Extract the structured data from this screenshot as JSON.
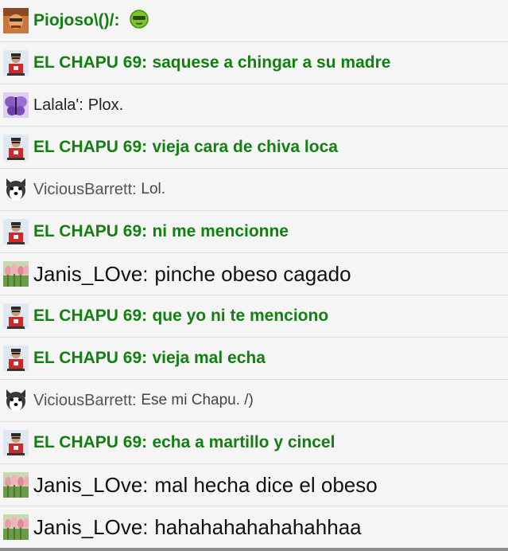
{
  "messages": [
    {
      "user": "Piojoso\\()/:",
      "text": "",
      "avatar": "orange-character-avatar",
      "style": "bold-green",
      "emoji": "green-cool-face"
    },
    {
      "user": "EL CHAPU 69:",
      "text": "saquese a chingar a su madre",
      "avatar": "man-red-shirt-avatar",
      "style": "bold-green"
    },
    {
      "user": "Lalala':",
      "text": "Plox.",
      "avatar": "purple-butterfly-avatar",
      "style": "plain-small"
    },
    {
      "user": "EL CHAPU 69:",
      "text": "vieja cara de chiva loca",
      "avatar": "man-red-shirt-avatar",
      "style": "bold-green"
    },
    {
      "user": "ViciousBarrett:",
      "text": "Lol.",
      "avatar": "husky-dog-avatar",
      "style": "plain-gray"
    },
    {
      "user": "EL CHAPU 69:",
      "text": "ni me mencionne",
      "avatar": "man-red-shirt-avatar",
      "style": "bold-green"
    },
    {
      "user": "Janis_LOve:",
      "text": "pinche obeso cagado",
      "avatar": "tulips-avatar",
      "style": "plain-large"
    },
    {
      "user": "EL CHAPU 69:",
      "text": "que yo ni te menciono",
      "avatar": "man-red-shirt-avatar",
      "style": "bold-green"
    },
    {
      "user": "EL CHAPU 69:",
      "text": "vieja mal echa",
      "avatar": "man-red-shirt-avatar",
      "style": "bold-green"
    },
    {
      "user": "ViciousBarrett:",
      "text": "Ese mi Chapu. /)",
      "avatar": "husky-dog-avatar",
      "style": "plain-gray"
    },
    {
      "user": "EL CHAPU 69:",
      "text": "echa a martillo y cincel",
      "avatar": "man-red-shirt-avatar",
      "style": "bold-green"
    },
    {
      "user": "Janis_LOve:",
      "text": "mal hecha dice el obeso",
      "avatar": "tulips-avatar",
      "style": "plain-large"
    },
    {
      "user": "Janis_LOve:",
      "text": "hahahahahahahahhaa",
      "avatar": "tulips-avatar",
      "style": "plain-large"
    }
  ],
  "colors": {
    "green": "#118011",
    "background": "#f5f5f5",
    "divider": "#dcdcdc"
  }
}
